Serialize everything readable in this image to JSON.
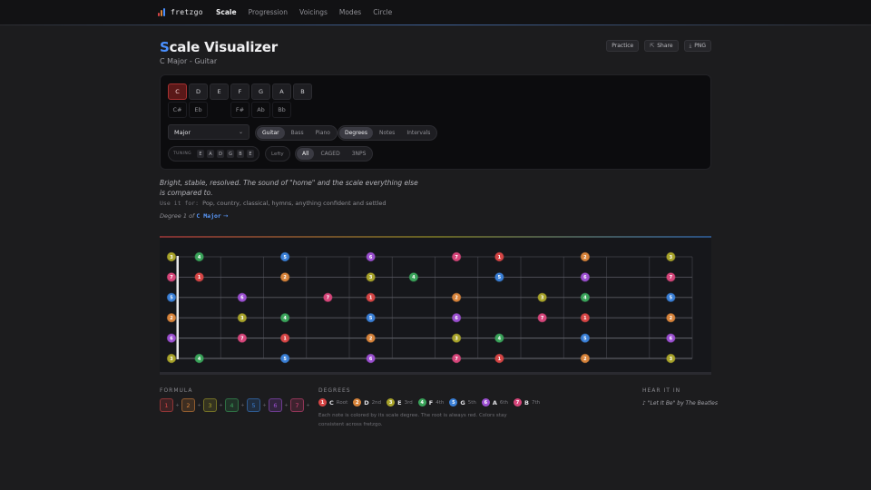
{
  "nav": {
    "brand": "fretzgo",
    "links": [
      {
        "label": "Scale",
        "active": true
      },
      {
        "label": "Progression",
        "active": false
      },
      {
        "label": "Voicings",
        "active": false
      },
      {
        "label": "Modes",
        "active": false
      },
      {
        "label": "Circle",
        "active": false
      }
    ]
  },
  "header": {
    "title_first": "S",
    "title_rest": "cale Visualizer",
    "subtitle": "C Major - Guitar",
    "actions": [
      {
        "label": "Practice",
        "icon": ""
      },
      {
        "label": "Share",
        "icon": "share-icon"
      },
      {
        "label": "PNG",
        "icon": "download-icon"
      }
    ]
  },
  "controls": {
    "naturals": [
      {
        "label": "C",
        "selected": true
      },
      {
        "label": "D"
      },
      {
        "label": "E"
      },
      {
        "label": "F"
      },
      {
        "label": "G"
      },
      {
        "label": "A"
      },
      {
        "label": "B"
      }
    ],
    "accidentals": [
      "C#",
      "Eb",
      "",
      "F#",
      "Ab",
      "Bb",
      ""
    ],
    "scale_select": "Major",
    "instrument": {
      "options": [
        "Guitar",
        "Bass",
        "Piano"
      ],
      "selected": "Guitar"
    },
    "label_mode": {
      "options": [
        "Degrees",
        "Notes",
        "Intervals"
      ],
      "selected": "Degrees"
    },
    "tuning_label": "TUNING",
    "tuning": [
      "E",
      "A",
      "D",
      "G",
      "B",
      "E"
    ],
    "lefty_label": "Lefty",
    "position": {
      "options": [
        "All",
        "CAGED",
        "3NPS"
      ],
      "selected": "All"
    }
  },
  "info": {
    "description": "Bright, stable, resolved. The sound of \"home\" and the scale everything else is compared to.",
    "use_label": "Use it for:",
    "use_text": "Pop, country, classical, hymns, anything confident and settled",
    "degree_prefix": "Degree 1 of",
    "degree_link": "C Major",
    "degree_arrow": "→"
  },
  "colors": {
    "1": "#d64545",
    "2": "#d7833a",
    "3": "#a8a32a",
    "4": "#3aa35a",
    "5": "#3a7fd6",
    "6": "#9b4fd0",
    "7": "#d6457a",
    "accent": "#4a90ff",
    "board": "#16171b"
  },
  "fretboard": {
    "frets": 12,
    "strings": [
      {
        "name": "e",
        "open": "3",
        "notes": [
          [
            1,
            "4"
          ],
          [
            3,
            "5"
          ],
          [
            5,
            "6"
          ],
          [
            7,
            "7"
          ],
          [
            8,
            "1"
          ],
          [
            10,
            "2"
          ],
          [
            12,
            "3"
          ]
        ]
      },
      {
        "name": "B",
        "open": "7",
        "notes": [
          [
            1,
            "1"
          ],
          [
            3,
            "2"
          ],
          [
            5,
            "3"
          ],
          [
            6,
            "4"
          ],
          [
            8,
            "5"
          ],
          [
            10,
            "6"
          ],
          [
            12,
            "7"
          ]
        ]
      },
      {
        "name": "G",
        "open": "5",
        "notes": [
          [
            2,
            "6"
          ],
          [
            4,
            "7"
          ],
          [
            5,
            "1"
          ],
          [
            7,
            "2"
          ],
          [
            9,
            "3"
          ],
          [
            10,
            "4"
          ],
          [
            12,
            "5"
          ]
        ]
      },
      {
        "name": "D",
        "open": "2",
        "notes": [
          [
            2,
            "3"
          ],
          [
            3,
            "4"
          ],
          [
            5,
            "5"
          ],
          [
            7,
            "6"
          ],
          [
            9,
            "7"
          ],
          [
            10,
            "1"
          ],
          [
            12,
            "2"
          ]
        ]
      },
      {
        "name": "A",
        "open": "6",
        "notes": [
          [
            2,
            "7"
          ],
          [
            3,
            "1"
          ],
          [
            5,
            "2"
          ],
          [
            7,
            "3"
          ],
          [
            8,
            "4"
          ],
          [
            10,
            "5"
          ],
          [
            12,
            "6"
          ]
        ]
      },
      {
        "name": "E",
        "open": "3",
        "notes": [
          [
            1,
            "4"
          ],
          [
            3,
            "5"
          ],
          [
            5,
            "6"
          ],
          [
            7,
            "7"
          ],
          [
            8,
            "1"
          ],
          [
            10,
            "2"
          ],
          [
            12,
            "3"
          ]
        ]
      }
    ]
  },
  "formula": {
    "title": "FORMULA",
    "steps": [
      "1",
      "2",
      "3",
      "4",
      "5",
      "6",
      "7"
    ],
    "separators": [
      "+",
      "+",
      "+",
      "+",
      "+",
      "+",
      "+"
    ]
  },
  "degrees_legend": {
    "title": "DEGREES",
    "items": [
      {
        "degree": "1",
        "note": "C",
        "interval": "Root"
      },
      {
        "degree": "2",
        "note": "D",
        "interval": "2nd"
      },
      {
        "degree": "3",
        "note": "E",
        "interval": "3rd"
      },
      {
        "degree": "4",
        "note": "F",
        "interval": "4th"
      },
      {
        "degree": "5",
        "note": "G",
        "interval": "5th"
      },
      {
        "degree": "6",
        "note": "A",
        "interval": "6th"
      },
      {
        "degree": "7",
        "note": "B",
        "interval": "7th"
      }
    ],
    "note": "Each note is colored by its scale degree. The root is always red. Colors stay consistent across fretzgo."
  },
  "hear_it": {
    "title": "HEAR IT IN",
    "text": "♪ \"Let It Be\" by The Beatles"
  }
}
